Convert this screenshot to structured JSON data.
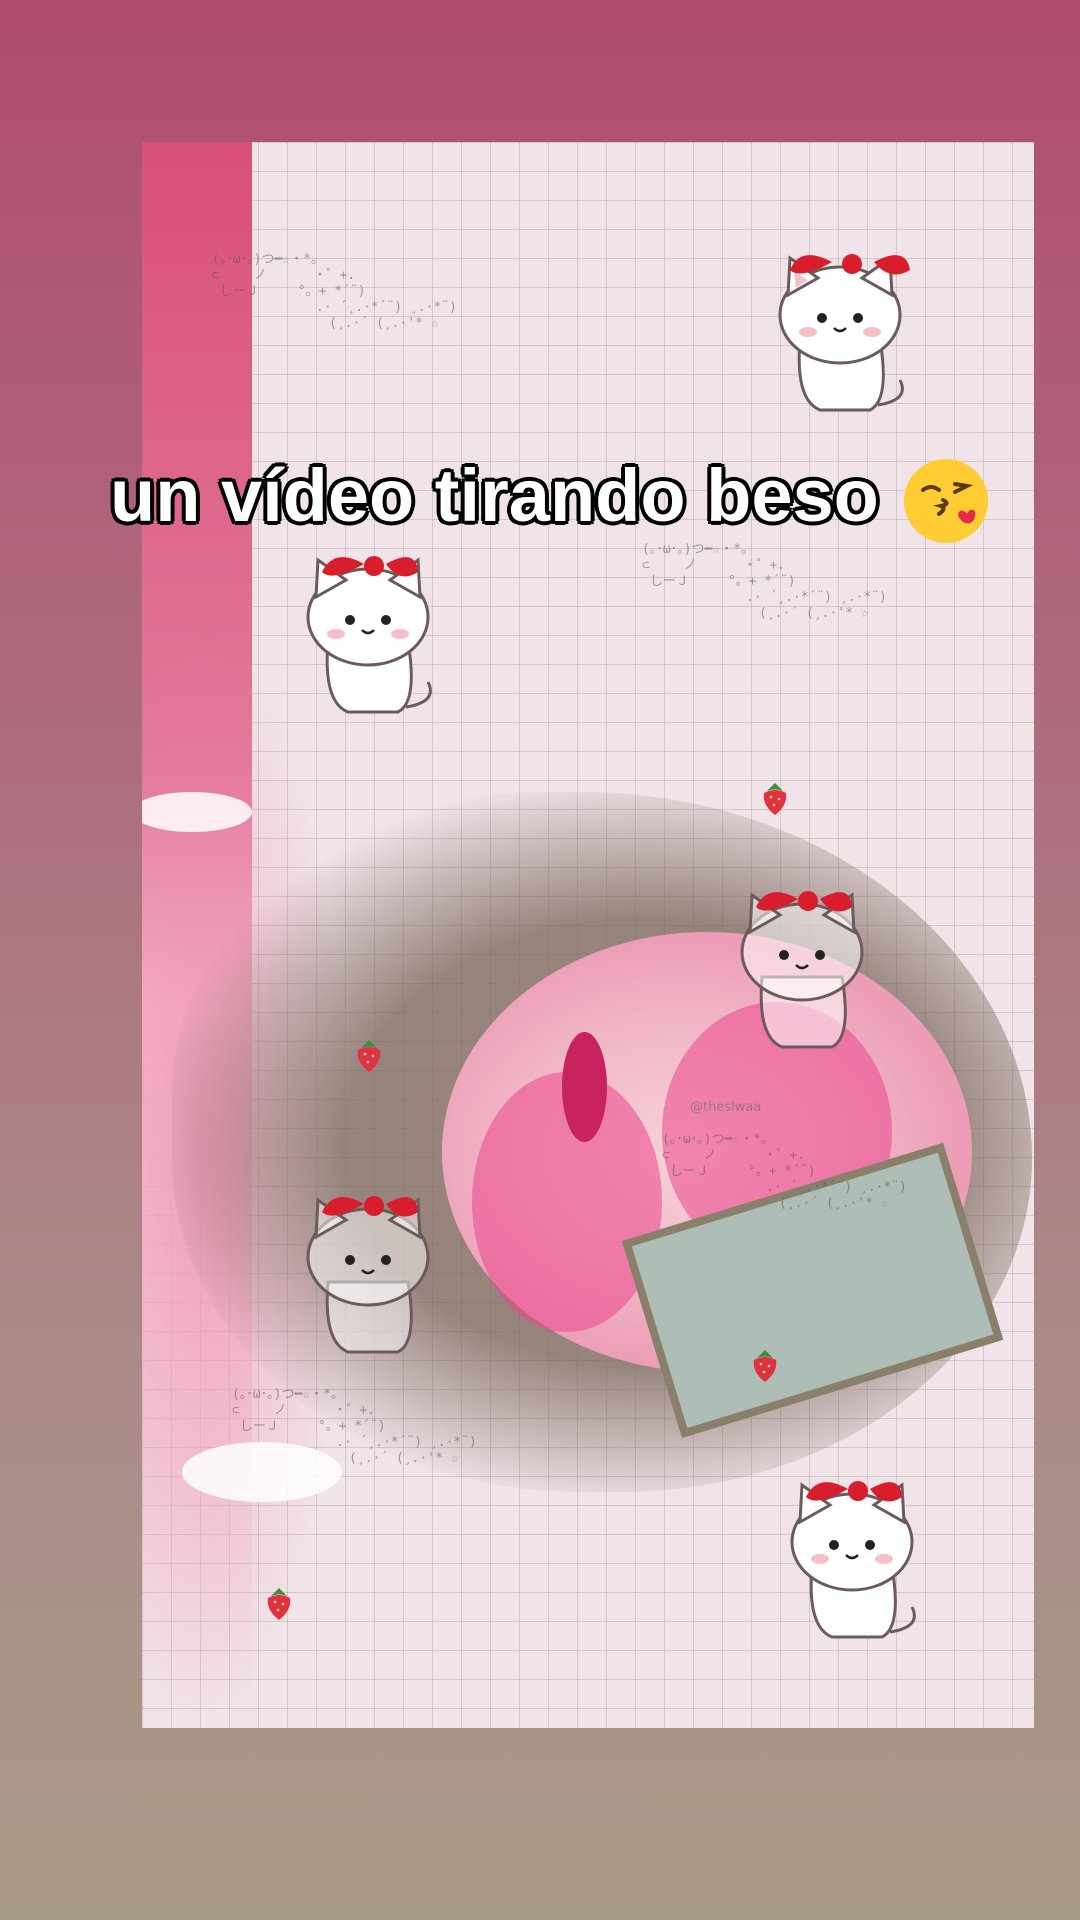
{
  "story": {
    "caption_text": "un vídeo tirando beso",
    "caption_emoji": "kiss-face-emoji",
    "watermark": "@theslwaa",
    "kaomoji": [
      "(｡･ω･｡)つ━☆・*。\n⊂　　 ノ 　　　・゜+.\n しーＪ　　　°。+ *´¨)\n　　　　　　　　.· ´¸.·*´¨) ¸.·*¨)\n　　　　　　　　　(¸.·´ (¸.·'* ☆"
    ]
  },
  "colors": {
    "background_top": "#b04c70",
    "background_bottom": "#a89a88",
    "accent_pink": "#d94f7a",
    "bow_red": "#d81e2c"
  },
  "stickers": {
    "kitty_icon": "white-kitten-with-red-bow-icon",
    "strawberry_icon": "strawberry-icon"
  }
}
